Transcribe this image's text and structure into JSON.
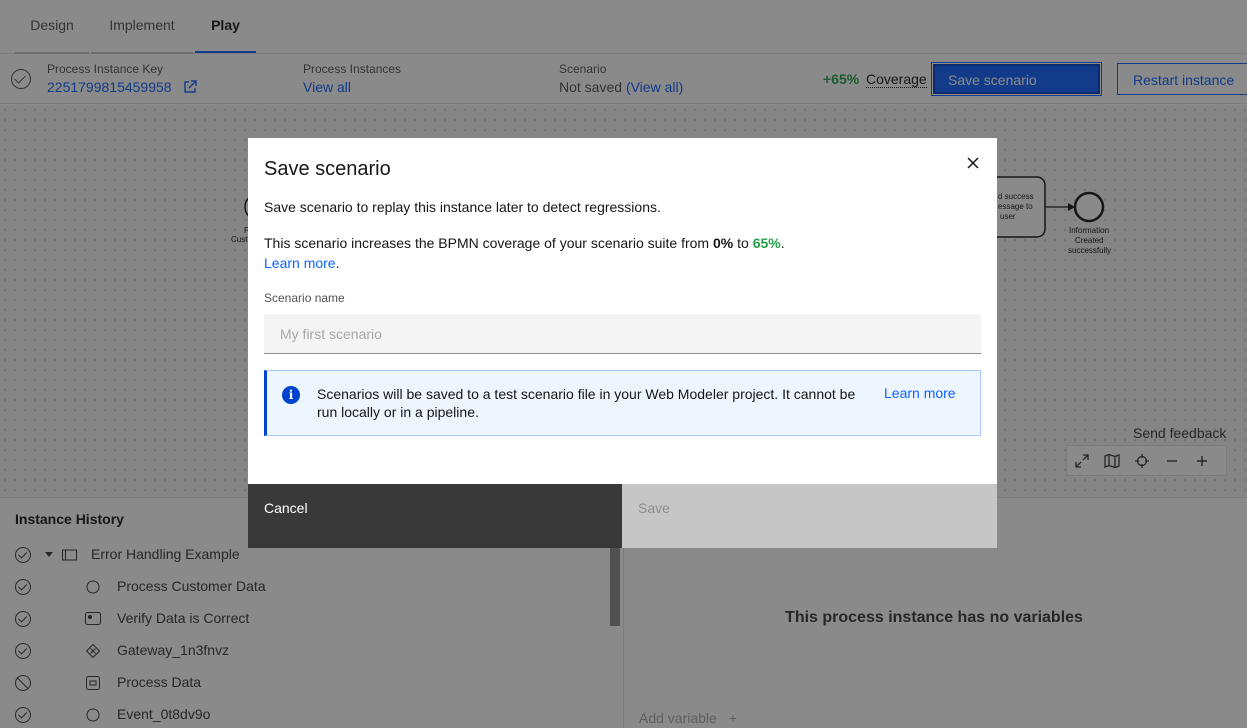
{
  "tabs": [
    {
      "label": "Design"
    },
    {
      "label": "Implement"
    },
    {
      "label": "Play"
    }
  ],
  "infobar": {
    "key_label": "Process Instance Key",
    "key_value": "2251799815459958",
    "instances_label": "Process Instances",
    "instances_link": "View all",
    "scenario_label": "Scenario",
    "scenario_value": "Not saved",
    "scenario_link": "(View all)",
    "coverage_pct": "+65%",
    "coverage_label": "Coverage",
    "save_scenario_button": "Save scenario",
    "restart_button": "Restart instance"
  },
  "canvas": {
    "send_feedback": "Send feedback",
    "node_left_partial": [
      "P",
      "Cust"
    ],
    "task_right_partial": [
      "d success",
      "essage to",
      "user"
    ],
    "end_event_label": [
      "Information",
      "Created",
      "successfully"
    ]
  },
  "history": {
    "title": "Instance History",
    "rows": [
      {
        "label": "Error Handling Example",
        "status": "completed",
        "type": "process"
      },
      {
        "label": "Process Customer Data",
        "status": "completed",
        "type": "start-event"
      },
      {
        "label": "Verify Data is Correct",
        "status": "completed",
        "type": "user-task"
      },
      {
        "label": "Gateway_1n3fnvz",
        "status": "completed",
        "type": "gateway"
      },
      {
        "label": "Process Data",
        "status": "terminated",
        "type": "service-task"
      },
      {
        "label": "Event_0t8dv9o",
        "status": "completed",
        "type": "event"
      }
    ]
  },
  "variables": {
    "empty_message": "This process instance has no variables",
    "add_variable": "Add variable"
  },
  "modal": {
    "title": "Save scenario",
    "intro": "Save scenario to replay this instance later to detect regressions.",
    "coverage_text_before": "This scenario increases the BPMN coverage of your scenario suite from ",
    "coverage_from": "0%",
    "coverage_to_word": " to ",
    "coverage_to": "65%",
    "coverage_end": ".",
    "learn_more": "Learn more",
    "field_label": "Scenario name",
    "field_placeholder": "My first scenario",
    "field_value": "",
    "notification_text": "Scenarios will be saved to a test scenario file in your Web Modeler project. It cannot be run locally or in a pipeline.",
    "notification_link": "Learn more",
    "cancel_button": "Cancel",
    "save_button": "Save"
  },
  "colors": {
    "primary": "#0f62fe",
    "success": "#24a148",
    "dark_button": "#393939",
    "disabled_button": "#c6c6c6",
    "info_bg": "#edf5ff"
  }
}
